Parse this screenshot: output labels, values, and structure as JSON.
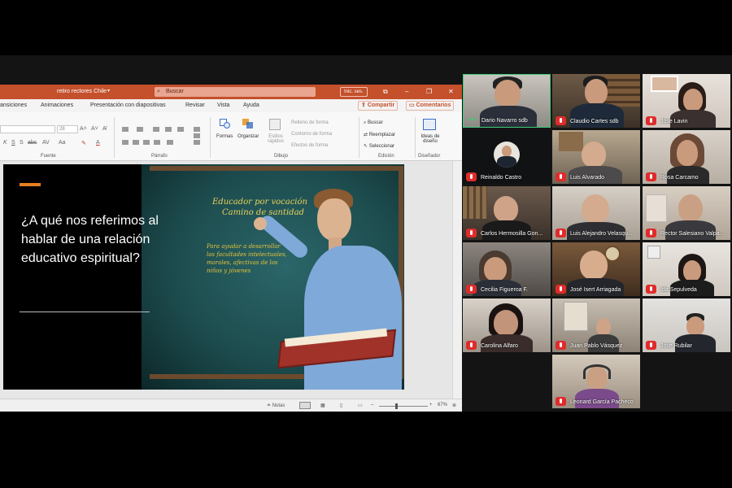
{
  "powerpoint": {
    "document_title": "retiro rectores Chile",
    "search_placeholder": "Buscar",
    "login_button": "Inic. ses.",
    "tabs": [
      "ansiciones",
      "Animaciones",
      "Presentación con diapositivas",
      "Revisar",
      "Vista",
      "Ayuda"
    ],
    "share_button": "Compartir",
    "comments_button": "Comentarios",
    "ribbon": {
      "font_size": "28",
      "groups": [
        "Fuente",
        "Párrafo",
        "Dibujo",
        "Edición",
        "Diseñador"
      ],
      "shapes_label": "Formas",
      "arrange_label": "Organizar",
      "quick_styles_label": "Estilos rápidos",
      "shape_fill": "Relleno de forma",
      "shape_outline": "Contorno de forma",
      "shape_effects": "Efectos de forma",
      "find": "Buscar",
      "replace": "Reemplazar",
      "select": "Seleccionar",
      "design_ideas": "Ideas de diseño"
    },
    "slide": {
      "question": "¿A qué nos referimos al hablar de una relación educativo espiritual?",
      "chalk_heading_1": "Educador por vocación",
      "chalk_heading_2": "Camino de santidad",
      "chalk_body": "Para ayudar a desarrollar las facultades intelectuales, morales, afectivas de los niños y jóvenes"
    },
    "status": {
      "notes": "Notas",
      "zoom": "67%"
    },
    "colors": {
      "titlebar": "#c4502c",
      "accent": "#e67e22"
    }
  },
  "zoom_gallery": {
    "participants": [
      {
        "name": "Dario Navarro sdb",
        "speaking": true
      },
      {
        "name": "Claudio Cartes sdb",
        "muted": true
      },
      {
        "name": "Jose Lavin",
        "muted": true
      },
      {
        "name": "Reinaldo Castro",
        "muted": true
      },
      {
        "name": "Luis Alvarado",
        "muted": true
      },
      {
        "name": "Rosa Carcamo",
        "muted": true
      },
      {
        "name": "Carlos Hermosilla Gon...",
        "muted": true
      },
      {
        "name": "Luis Alejandro Velasqu...",
        "muted": true
      },
      {
        "name": "Rector Salesiano Valpa...",
        "muted": true
      },
      {
        "name": "Cecilia Figueroa F.",
        "muted": true
      },
      {
        "name": "José Isert Arriagada",
        "muted": true
      },
      {
        "name": "Ida Sepulveda",
        "muted": true
      },
      {
        "name": "Carolina Alfaro",
        "muted": true
      },
      {
        "name": "Juan Pablo Vásquez",
        "muted": true
      },
      {
        "name": "Jose Rubilar",
        "muted": true
      },
      {
        "name": "Leonard García Pacheco",
        "muted": true
      }
    ]
  }
}
